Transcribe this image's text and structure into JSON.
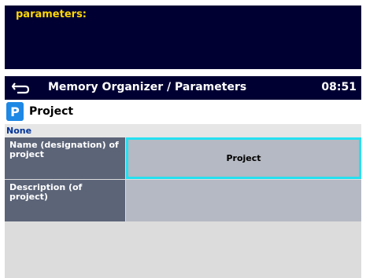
{
  "top_panel": {
    "text": "parameters:"
  },
  "header": {
    "title": "Memory Organizer / Parameters",
    "time": "08:51"
  },
  "object": {
    "icon_letter": "P",
    "title": "Project"
  },
  "subtitle": "None",
  "parameters": [
    {
      "label": "Name (designation) of project",
      "value": "Project",
      "selected": true
    },
    {
      "label": "Description (of project)",
      "value": "",
      "selected": false
    }
  ],
  "colors": {
    "header_bg": "#000033",
    "label_bg": "#5c6478",
    "value_bg": "#b5b9c3",
    "selection": "#25e0f0",
    "accent_text": "#ffd700",
    "icon_bg": "#1e88e5"
  },
  "icons": {
    "back": "back-arrow-icon",
    "project": "project-p-icon"
  }
}
